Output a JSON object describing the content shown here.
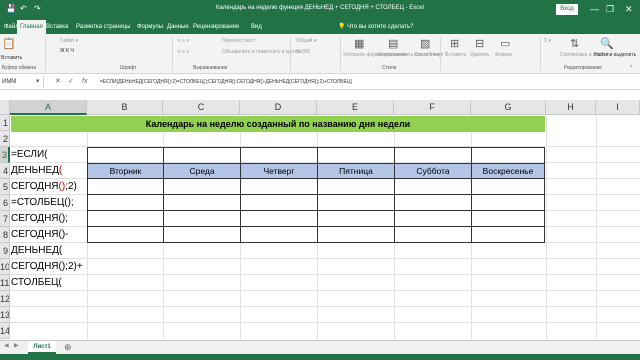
{
  "window": {
    "title": "Календарь на неделю функция ДЕНЬНЕД + СЕГОДНЯ + СТОЛБЕЦ  -  Excel",
    "login": "Вход",
    "minimize": "—",
    "restore": "❐",
    "close": "✕"
  },
  "qat": {
    "save": "💾",
    "undo": "↶",
    "redo": "↷"
  },
  "ribbon_tabs": [
    "Файл",
    "Главная",
    "Вставка",
    "Разметка страницы",
    "Формулы",
    "Данные",
    "Рецензирование",
    "Вид"
  ],
  "tell_me": "Что вы хотите сделать?",
  "ribbon": {
    "paste": "Вставить",
    "clipboard": "Буфер обмена",
    "font": "Шрифт",
    "alignment": "Выравнивание",
    "styles": "Стили",
    "editing": "Редактирование",
    "wrap_text": "Перенос текст",
    "merge": "Объединить и поместить в центре",
    "conditional_formatting": "Условное форматирование",
    "format_as_table": "Форматировать как таблицу",
    "cell_styles": "Стили ячеек",
    "insert": "Вставить",
    "delete": "Удалить",
    "format": "Формат",
    "sort_filter": "Сортировка и фильтр",
    "find_select": "Найти и выделить"
  },
  "formula_bar": {
    "name_box": "ИММ",
    "cancel": "✕",
    "enter": "✓",
    "fx": "fx",
    "formula": "=ЕСЛИ(ДЕНЬНЕД(СЕГОДНЯ();2)=СТОЛБЕЦ();СЕГОДНЯ();СЕГОДНЯ()-ДЕНЬНЕД(СЕГОДНЯ();2)+СТОЛБЕЦ("
  },
  "columns": [
    "A",
    "B",
    "C",
    "D",
    "E",
    "F",
    "G",
    "H",
    "I"
  ],
  "rows": [
    "1",
    "2",
    "3",
    "4",
    "5",
    "6",
    "7",
    "8",
    "9",
    "10",
    "11",
    "12",
    "13",
    "14"
  ],
  "banner": "Календарь на неделю созданный по названию дня недели",
  "weekdays": [
    "Вторник",
    "Среда",
    "Четверг",
    "Пятница",
    "Суббота",
    "Воскресенье"
  ],
  "cell_edit": {
    "line1": "=ЕСЛИ(",
    "line2": "ДЕНЬНЕД(",
    "line3a": "СЕГОДНЯ();2)",
    "line4": "=СТОЛБЕЦ();",
    "line5": "СЕГОДНЯ();",
    "line6": "СЕГОДНЯ()-",
    "line7": "ДЕНЬНЕД(",
    "line8": "СЕГОДНЯ();2)+",
    "line9": "СТОЛБЕЦ("
  },
  "sheet_tab": "Лист1",
  "add_sheet": "⊕",
  "colors": {
    "excel_green": "#217346",
    "banner_green": "#92d050",
    "header_blue": "#b4c6e7",
    "formula_red": "#c00000"
  }
}
